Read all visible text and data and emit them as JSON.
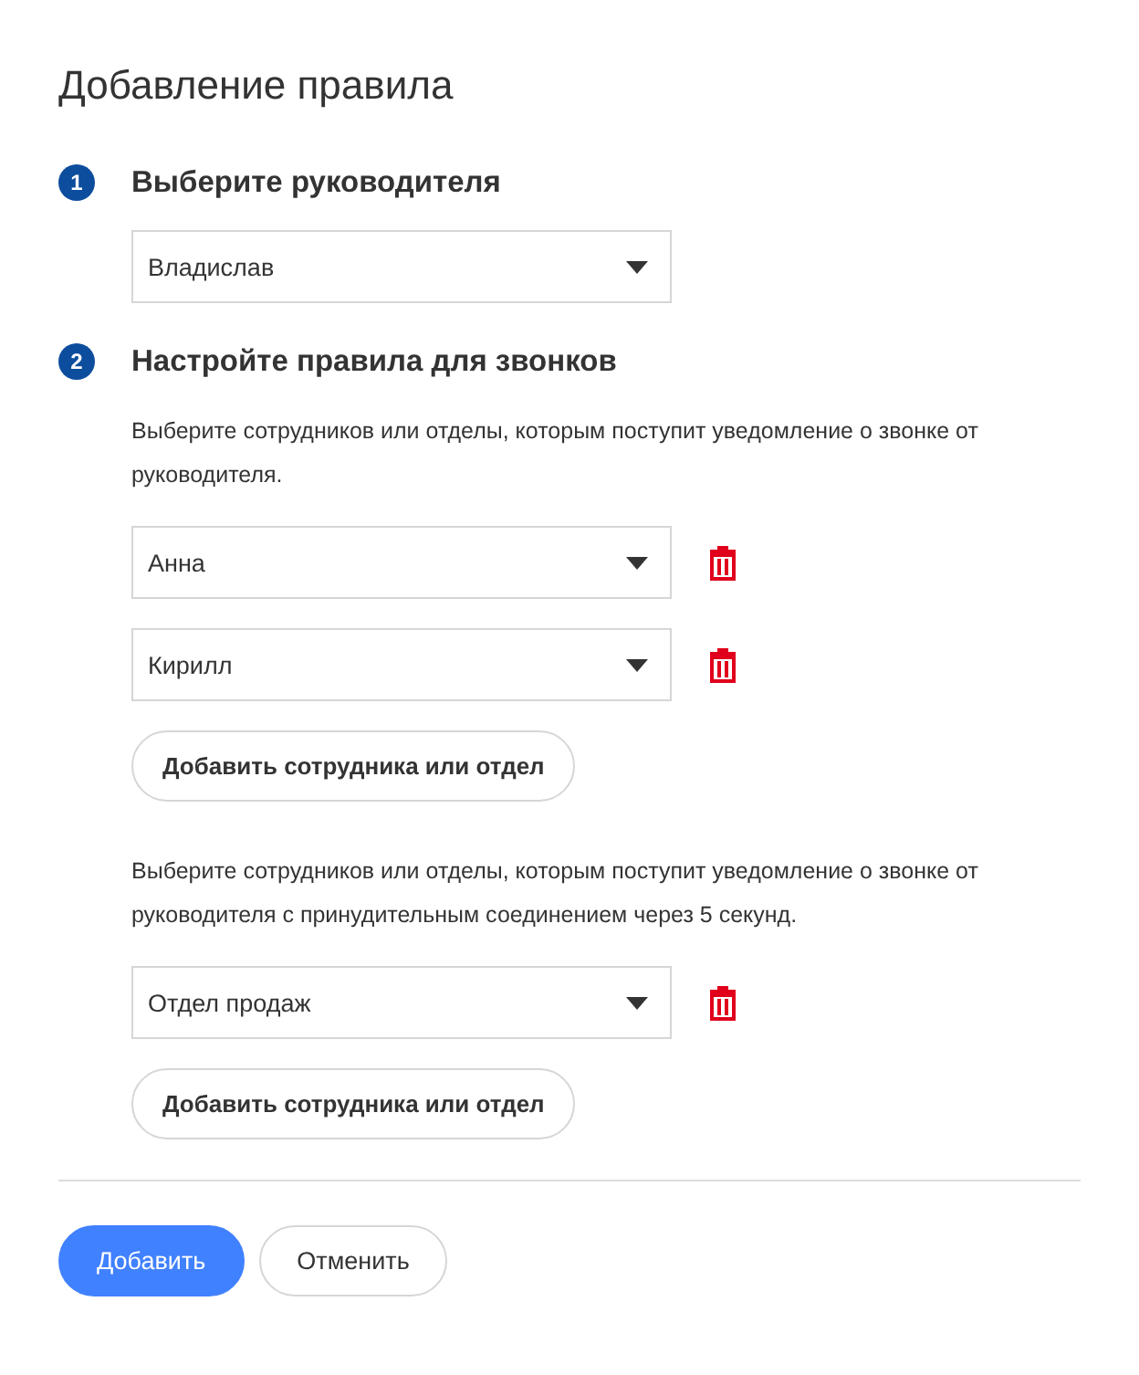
{
  "title": "Добавление правила",
  "steps": [
    {
      "number": "1",
      "title": "Выберите руководителя",
      "sections": [
        {
          "selects": [
            {
              "value": "Владислав",
              "removable": false
            }
          ]
        }
      ]
    },
    {
      "number": "2",
      "title": "Настройте правила для звонков",
      "sections": [
        {
          "description": "Выберите сотрудников или отделы, которым поступит уведомление о звонке от руководителя.",
          "selects": [
            {
              "value": "Анна",
              "removable": true
            },
            {
              "value": "Кирилл",
              "removable": true
            }
          ],
          "add_button": "Добавить сотрудника или отдел"
        },
        {
          "description": "Выберите сотрудников или отделы, которым поступит уведомление о звонке от руководителя с принудительным соединением через 5 секунд.",
          "selects": [
            {
              "value": "Отдел продаж",
              "removable": true
            }
          ],
          "add_button": "Добавить сотрудника или отдел"
        }
      ]
    }
  ],
  "actions": [
    {
      "label": "Добавить",
      "kind": "primary"
    },
    {
      "label": "Отменить",
      "kind": "secondary"
    }
  ]
}
